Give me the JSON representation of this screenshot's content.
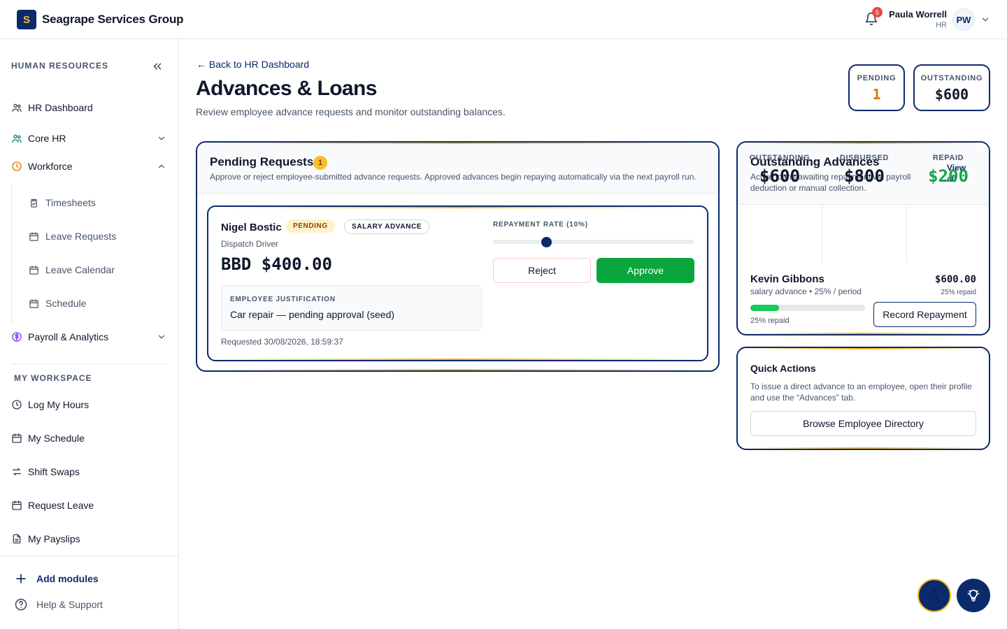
{
  "brand": {
    "logo_letter": "S",
    "name": "Seagrape Services Group"
  },
  "header": {
    "notification_count": "5",
    "user_name": "Paula Worrell",
    "user_role": "HR",
    "user_initials": "PW"
  },
  "sidebar": {
    "section_hr": "HUMAN RESOURCES",
    "items": [
      {
        "label": "HR Dashboard",
        "icon": "users-icon"
      },
      {
        "label": "Core HR",
        "icon": "team-icon"
      },
      {
        "label": "Workforce",
        "icon": "clock-icon"
      },
      {
        "label": "Payroll & Analytics",
        "icon": "dollar-icon"
      }
    ],
    "workforce_sub": [
      {
        "label": "Timesheets",
        "icon": "clipboard-icon"
      },
      {
        "label": "Leave Requests",
        "icon": "calendar-icon"
      },
      {
        "label": "Leave Calendar",
        "icon": "calendar-icon"
      },
      {
        "label": "Schedule",
        "icon": "calendar-icon"
      }
    ],
    "section_workspace": "MY WORKSPACE",
    "workspace": [
      {
        "label": "Log My Hours",
        "icon": "clock-icon"
      },
      {
        "label": "My Schedule",
        "icon": "calendar-icon"
      },
      {
        "label": "Shift Swaps",
        "icon": "swap-icon"
      },
      {
        "label": "Request Leave",
        "icon": "calendar-icon"
      },
      {
        "label": "My Payslips",
        "icon": "document-icon"
      }
    ],
    "add_modules": "Add modules",
    "help": "Help & Support"
  },
  "page": {
    "back_link": "← Back to HR Dashboard",
    "title": "Advances & Loans",
    "subtitle": "Review employee advance requests and monitor outstanding balances."
  },
  "summary": {
    "pending_label": "PENDING",
    "pending_value": "1",
    "outstanding_label": "OUTSTANDING",
    "outstanding_value": "$600"
  },
  "pending_requests": {
    "title": "Pending Requests",
    "count": "1",
    "description": "Approve or reject employee-submitted advance requests. Approved advances begin repaying automatically via the next payroll run.",
    "request": {
      "name": "Nigel Bostic",
      "status_badge": "PENDING",
      "type_badge": "SALARY ADVANCE",
      "role": "Dispatch Driver",
      "amount": "BBD $400.00",
      "justification_label": "EMPLOYEE JUSTIFICATION",
      "justification": "Car repair — pending approval (seed)",
      "requested": "Requested 30/08/2026, 18:59:37",
      "rate_label": "REPAYMENT RATE (10%)",
      "rate_fraction": 0.265,
      "reject_label": "Reject",
      "approve_label": "Approve"
    }
  },
  "outstanding": {
    "title": "Outstanding Advances",
    "description": "Active loans awaiting repayment via payroll deduction or manual collection.",
    "view_all": "View all →",
    "stats": [
      {
        "label": "OUTSTANDING",
        "value": "$600",
        "color": "#0f172a"
      },
      {
        "label": "DISBURSED",
        "value": "$800",
        "color": "#0f172a"
      },
      {
        "label": "REPAID",
        "value": "$200",
        "color": "#16a34a"
      }
    ],
    "loan": {
      "name": "Kevin Gibbons",
      "meta": "salary advance • 25% / period",
      "amount": "$600.00",
      "repaid_pct_text": "25% repaid",
      "progress": 0.25,
      "bar_label": "25% repaid",
      "record_label": "Record Repayment"
    }
  },
  "quick_actions": {
    "title": "Quick Actions",
    "description": "To issue a direct advance to an employee, open their profile and use the “Advances” tab.",
    "browse_label": "Browse Employee Directory"
  },
  "colors": {
    "brand_navy": "#0b2a6b",
    "accent_gold": "#f5b81c",
    "approve_green": "#0aa63d",
    "pending_orange": "#d97706"
  }
}
